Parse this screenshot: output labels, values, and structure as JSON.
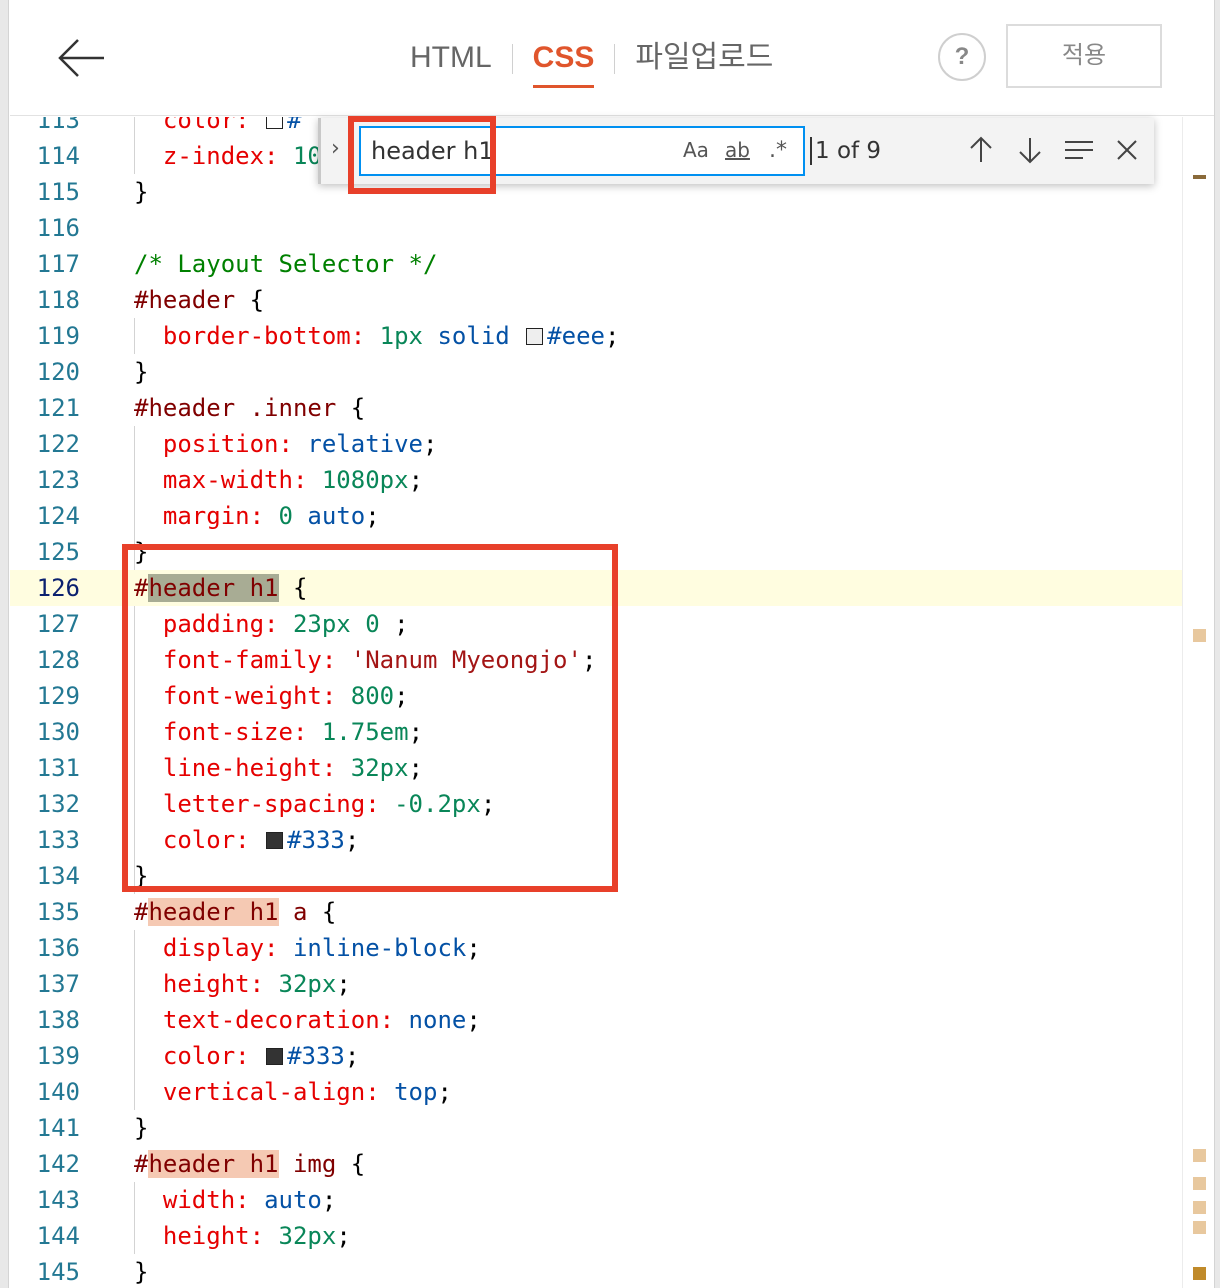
{
  "toolbar": {
    "tabs": [
      {
        "label": "HTML",
        "active": false
      },
      {
        "label": "CSS",
        "active": true
      },
      {
        "label": "파일업로드",
        "active": false
      }
    ],
    "help_label": "?",
    "apply_label": "적용"
  },
  "find": {
    "query": "header h1",
    "match_case_label": "Aa",
    "whole_word_label": "ab",
    "regex_label": ".*",
    "count": "1 of 9"
  },
  "editor": {
    "current_line": "126",
    "lines": [
      {
        "n": "113",
        "content": "  color: #"
      },
      {
        "n": "114",
        "content": "  z-index: 10"
      },
      {
        "n": "115",
        "content": "}"
      },
      {
        "n": "116",
        "content": ""
      },
      {
        "n": "117",
        "content": "/* Layout Selector */"
      },
      {
        "n": "118",
        "content": "#header {"
      },
      {
        "n": "119",
        "content": "  border-bottom: 1px solid #eee;"
      },
      {
        "n": "120",
        "content": "}"
      },
      {
        "n": "121",
        "content": "#header .inner {"
      },
      {
        "n": "122",
        "content": "  position: relative;"
      },
      {
        "n": "123",
        "content": "  max-width: 1080px;"
      },
      {
        "n": "124",
        "content": "  margin: 0 auto;"
      },
      {
        "n": "125",
        "content": "}"
      },
      {
        "n": "126",
        "content": "#header h1 {"
      },
      {
        "n": "127",
        "content": "  padding: 23px 0 ;"
      },
      {
        "n": "128",
        "content": "  font-family: 'Nanum Myeongjo';"
      },
      {
        "n": "129",
        "content": "  font-weight: 800;"
      },
      {
        "n": "130",
        "content": "  font-size: 1.75em;"
      },
      {
        "n": "131",
        "content": "  line-height: 32px;"
      },
      {
        "n": "132",
        "content": "  letter-spacing: -0.2px;"
      },
      {
        "n": "133",
        "content": "  color: #333;"
      },
      {
        "n": "134",
        "content": "}"
      },
      {
        "n": "135",
        "content": "#header h1 a {"
      },
      {
        "n": "136",
        "content": "  display: inline-block;"
      },
      {
        "n": "137",
        "content": "  height: 32px;"
      },
      {
        "n": "138",
        "content": "  text-decoration: none;"
      },
      {
        "n": "139",
        "content": "  color: #333;"
      },
      {
        "n": "140",
        "content": "  vertical-align: top;"
      },
      {
        "n": "141",
        "content": "}"
      },
      {
        "n": "142",
        "content": "#header h1 img {"
      },
      {
        "n": "143",
        "content": "  width: auto;"
      },
      {
        "n": "144",
        "content": "  height: 32px;"
      },
      {
        "n": "145",
        "content": "}"
      }
    ]
  },
  "colors": {
    "accent": "#e0552c",
    "annotation": "#e8402a",
    "selector": "#800000",
    "property": "#e50000",
    "keyword_value": "#0451a5",
    "number": "#098658",
    "string": "#a31515",
    "comment": "#008000",
    "line_number": "#237893",
    "current_match_bg": "#a8ac94",
    "other_match_bg": "#f5c9b3",
    "current_line_bg": "#fffde0"
  },
  "icons": {
    "back": "arrow-left-icon",
    "help": "question-icon",
    "prev_match": "arrow-up-icon",
    "next_match": "arrow-down-icon",
    "find_in_selection": "lines-icon",
    "close": "close-icon",
    "toggle_replace": "chevron-right-icon"
  }
}
